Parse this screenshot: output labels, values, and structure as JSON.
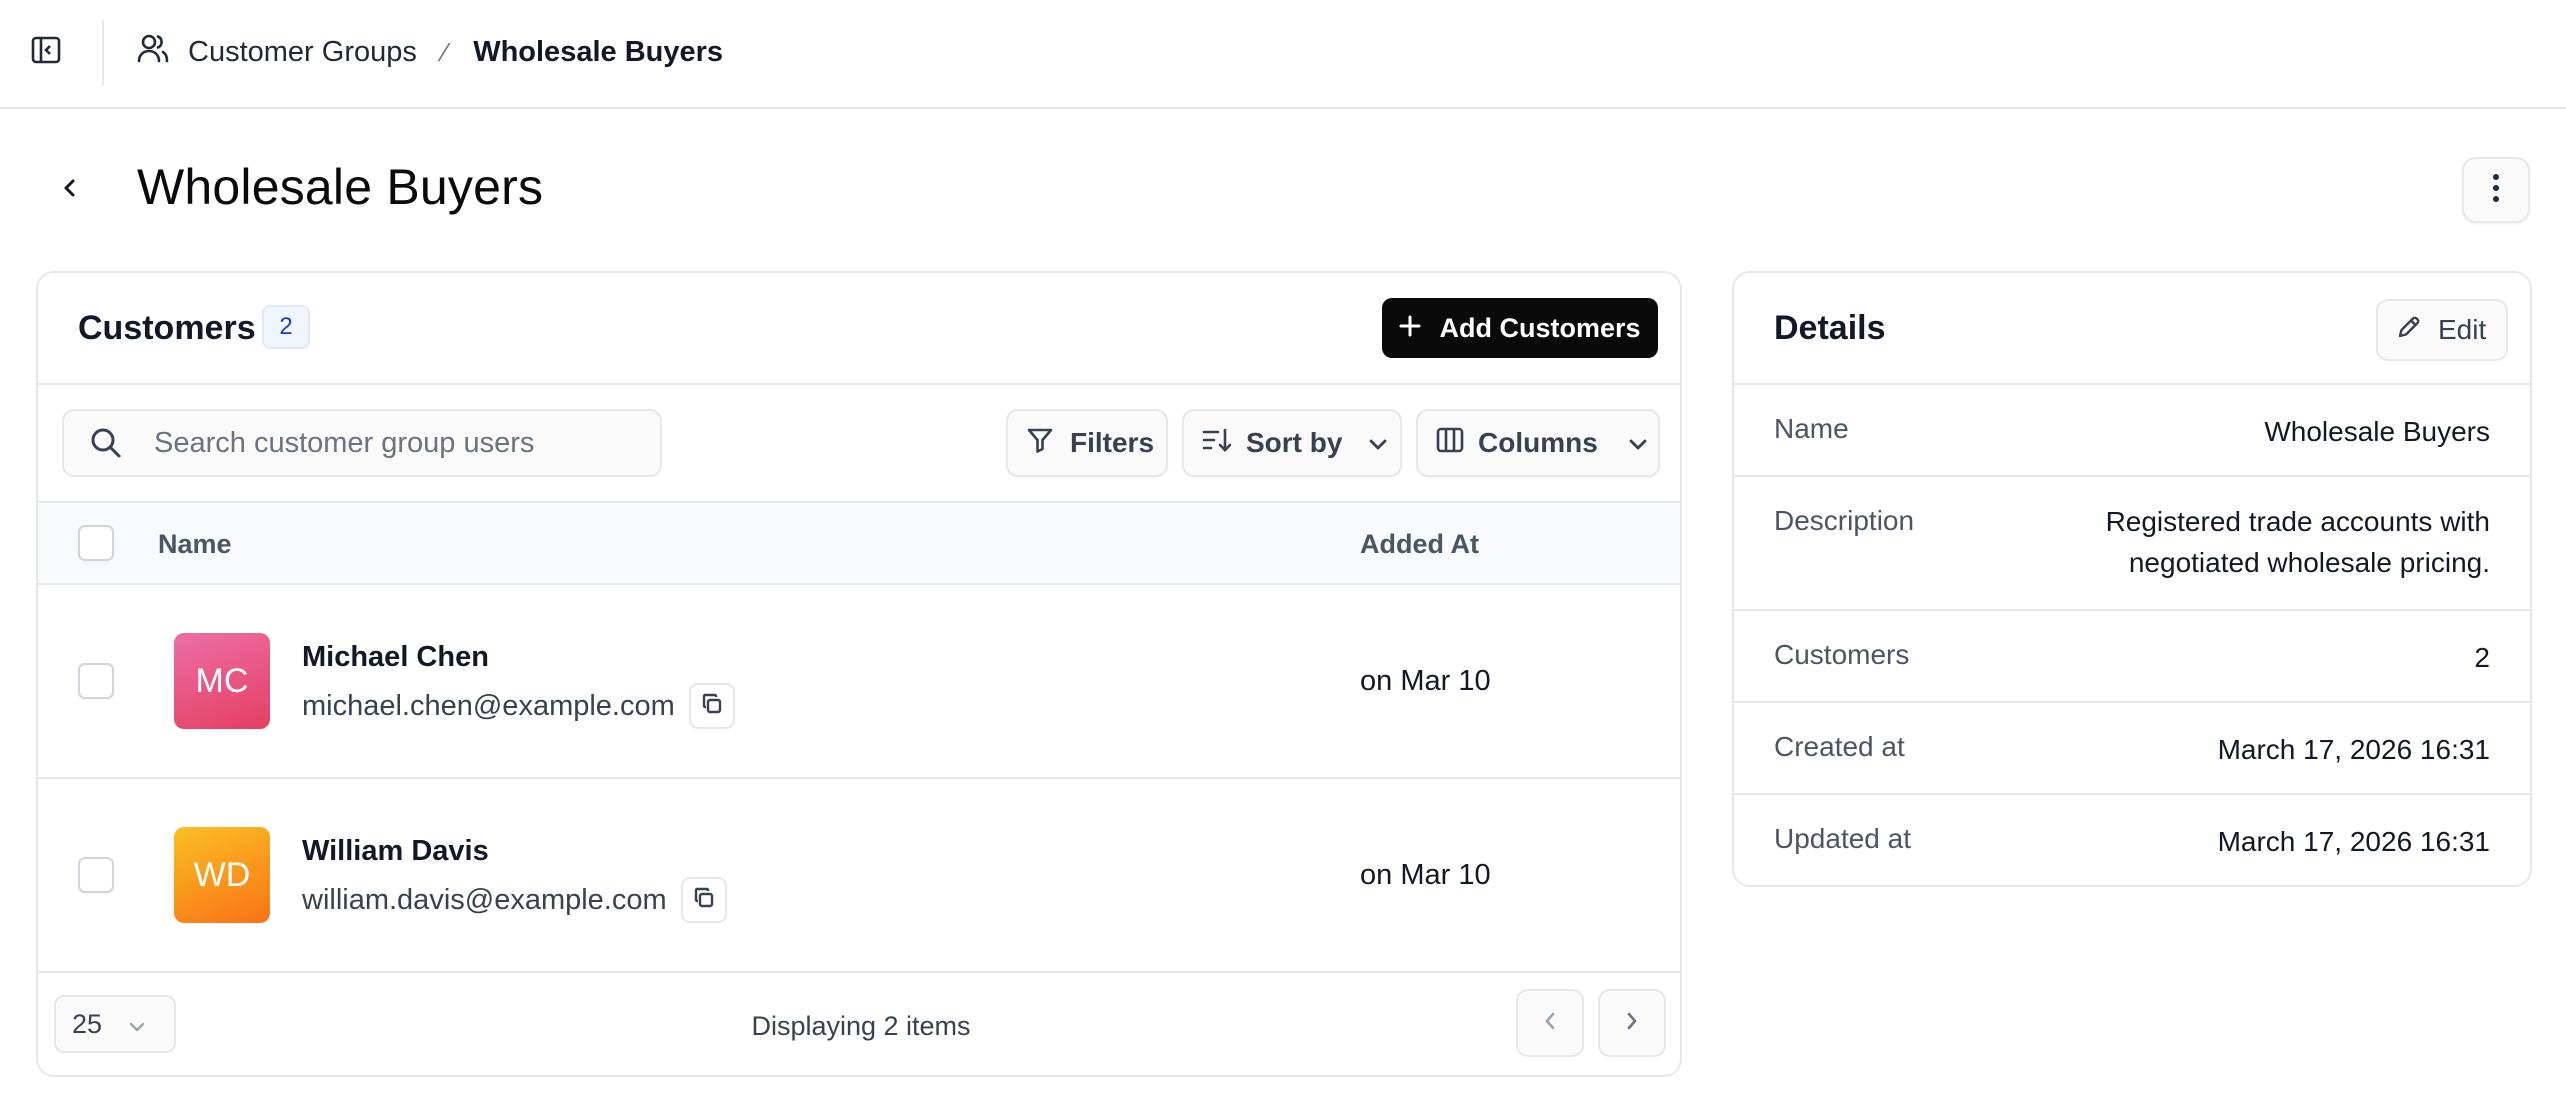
{
  "breadcrumb": {
    "parent": "Customer Groups",
    "separator": "⁄",
    "current": "Wholesale Buyers"
  },
  "page": {
    "title": "Wholesale Buyers"
  },
  "customers_card": {
    "title": "Customers",
    "count": "2",
    "add_button": "Add Customers",
    "search_placeholder": "Search customer group users",
    "filters_label": "Filters",
    "sort_label": "Sort by",
    "columns_label": "Columns",
    "columns": [
      "Name",
      "Added At"
    ],
    "rows": [
      {
        "initials": "MC",
        "name": "Michael Chen",
        "email": "michael.chen@example.com",
        "added_at": "on Mar 10",
        "avatar_color": "#e84a76"
      },
      {
        "initials": "WD",
        "name": "William Davis",
        "email": "william.davis@example.com",
        "added_at": "on Mar 10",
        "avatar_color": "#f59e0b"
      }
    ],
    "page_size": "25",
    "displaying": "Displaying 2 items"
  },
  "details_card": {
    "title": "Details",
    "edit_label": "Edit",
    "rows": [
      {
        "label": "Name",
        "value": "Wholesale Buyers"
      },
      {
        "label": "Description",
        "value_line1": "Registered trade accounts with",
        "value_line2": "negotiated wholesale pricing."
      },
      {
        "label": "Customers",
        "value": "2"
      },
      {
        "label": "Created at",
        "value": "March 17, 2026 16:31"
      },
      {
        "label": "Updated at",
        "value": "March 17, 2026 16:31"
      }
    ]
  },
  "icons": {
    "sidebar_toggle": "sidebar-toggle-icon",
    "users": "users-icon",
    "back": "chevron-left-icon",
    "more": "more-vertical-icon",
    "plus": "plus-icon",
    "search": "search-icon",
    "filter": "filter-icon",
    "sort": "sort-icon",
    "columns": "columns-icon",
    "copy": "copy-icon",
    "edit": "pencil-icon"
  },
  "colors": {
    "primary_button": "#0a0a0a",
    "border": "#e5e7eb",
    "badge_bg": "#eff6ff"
  }
}
